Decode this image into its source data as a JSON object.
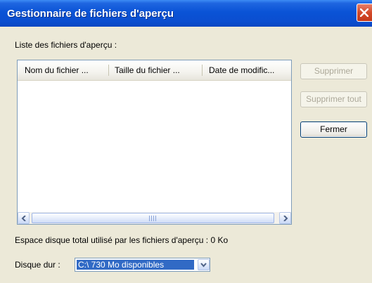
{
  "window": {
    "title": "Gestionnaire de fichiers d'aperçu"
  },
  "list_section": {
    "label": "Liste des fichiers d'aperçu :",
    "columns": [
      "Nom du fichier ...",
      "Taille du fichier ...",
      "Date de modific..."
    ],
    "rows": [],
    "scroll_thumb_label": "III"
  },
  "buttons": {
    "delete": "Supprimer",
    "delete_all": "Supprimer tout",
    "close": "Fermer"
  },
  "disk_usage": {
    "text": "Espace disque total utilisé par les fichiers d'aperçu : 0 Ko"
  },
  "drive": {
    "label": "Disque dur :",
    "selected": "C:\\ 730 Mo disponibles"
  },
  "colors": {
    "title_bar": "#0a53d6",
    "close_button": "#d34a2a",
    "selection": "#316ac5",
    "dialog_bg": "#ece9d8"
  },
  "icons": {
    "close": "close-icon",
    "scroll_left": "arrow-left-icon",
    "scroll_right": "arrow-right-icon",
    "dropdown": "chevron-down-icon"
  }
}
